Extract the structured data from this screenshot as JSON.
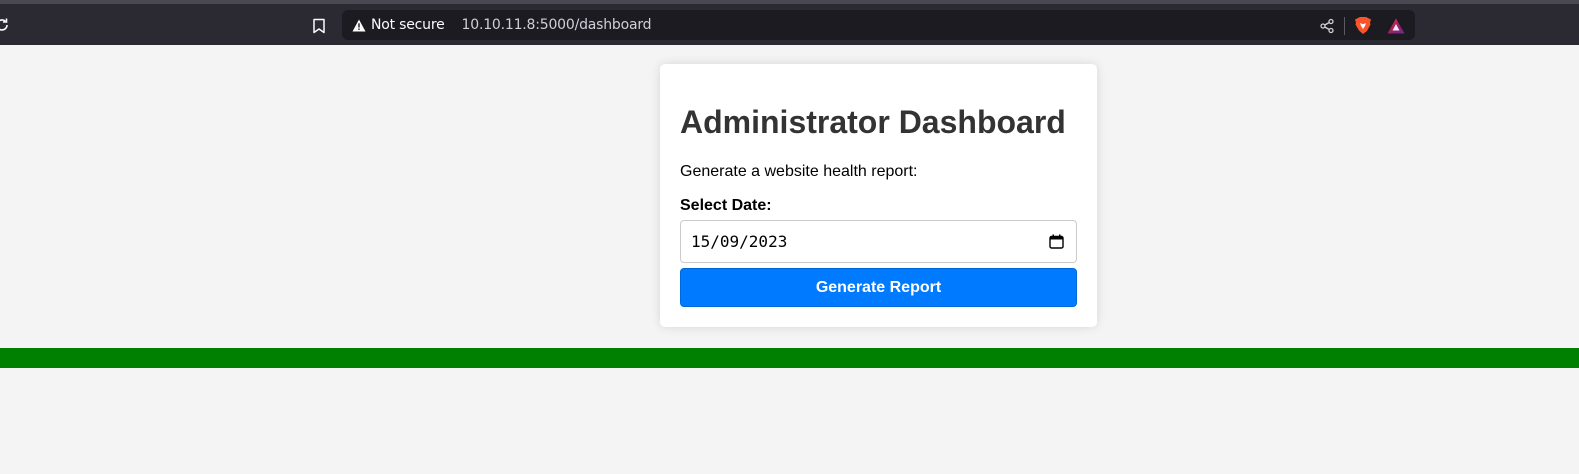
{
  "browser": {
    "security_label": "Not secure",
    "url": "10.10.11.8:5000/dashboard",
    "icons": [
      "reload-icon",
      "bookmark-icon",
      "warning-icon",
      "share-icon",
      "brave-shield-icon",
      "brave-rewards-icon"
    ]
  },
  "card": {
    "title": "Administrator Dashboard",
    "subtitle": "Generate a website health report:",
    "date_label": "Select Date:",
    "date_value": "15/09/2023",
    "button_label": "Generate Report"
  },
  "colors": {
    "button": "#007bff",
    "status_strip": "#008000",
    "page_bg": "#f4f4f4",
    "browser_bg": "#2b2a33"
  }
}
